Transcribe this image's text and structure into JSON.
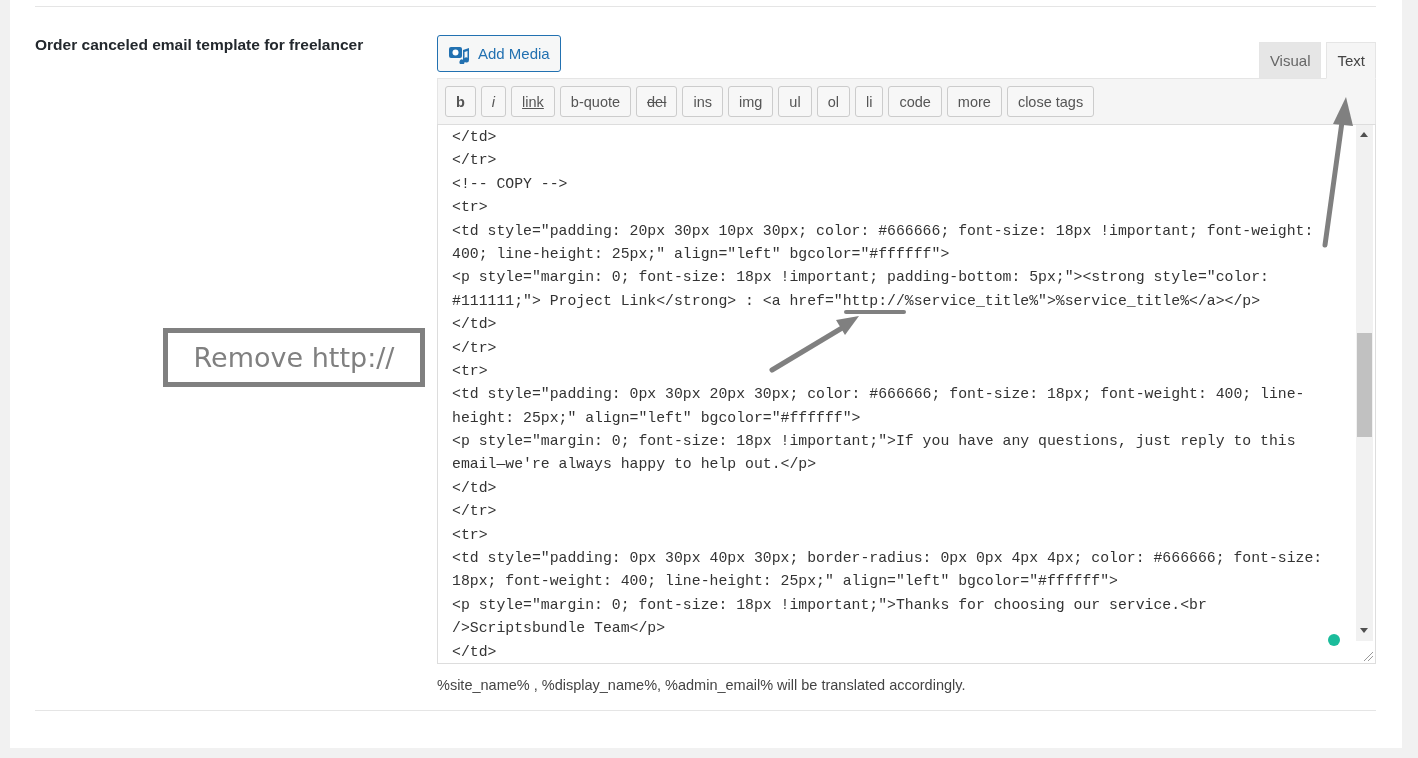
{
  "field_label": "Order canceled email template for freelancer",
  "add_media": {
    "label": "Add Media"
  },
  "tabs": [
    {
      "label": "Visual",
      "selected": false
    },
    {
      "label": "Text",
      "selected": true
    }
  ],
  "toolbar": [
    {
      "label": "b",
      "kind": "bold"
    },
    {
      "label": "i",
      "kind": "italic"
    },
    {
      "label": "link",
      "kind": "underline"
    },
    {
      "label": "b-quote",
      "kind": "plain"
    },
    {
      "label": "del",
      "kind": "strike"
    },
    {
      "label": "ins",
      "kind": "plain"
    },
    {
      "label": "img",
      "kind": "plain"
    },
    {
      "label": "ul",
      "kind": "plain"
    },
    {
      "label": "ol",
      "kind": "plain"
    },
    {
      "label": "li",
      "kind": "plain"
    },
    {
      "label": "code",
      "kind": "plain"
    },
    {
      "label": "more",
      "kind": "plain"
    },
    {
      "label": "close tags",
      "kind": "plain"
    }
  ],
  "code_lines": [
    "</td>",
    "</tr>",
    "<!-- COPY -->",
    "<tr>",
    "<td style=\"padding: 20px 30px 10px 30px; color: #666666; font-size: 18px !important; font-weight:",
    "400; line-height: 25px;\" align=\"left\" bgcolor=\"#ffffff\">",
    "<p style=\"margin: 0; font-size: 18px !important; padding-bottom: 5px;\"><strong style=\"color:",
    "#111111;\"> Project Link</strong> : <a href=\"http://%service_title%\">%service_title%</a></p>",
    "</td>",
    "</tr>",
    "<tr>",
    "<td style=\"padding: 0px 30px 20px 30px; color: #666666; font-size: 18px; font-weight: 400; line-",
    "height: 25px;\" align=\"left\" bgcolor=\"#ffffff\">",
    "<p style=\"margin: 0; font-size: 18px !important;\">If you have any questions, just reply to this",
    "email—we're always happy to help out.</p>",
    "</td>",
    "</tr>",
    "<tr>",
    "<td style=\"padding: 0px 30px 40px 30px; border-radius: 0px 0px 4px 4px; color: #666666; font-size:",
    "18px; font-weight: 400; line-height: 25px;\" align=\"left\" bgcolor=\"#ffffff\">",
    "<p style=\"margin: 0; font-size: 18px !important;\">Thanks for choosing our service.<br",
    "/>Scriptsbundle Team</p>",
    "</td>"
  ],
  "description": "%site_name% , %display_name%, %admin_email% will be translated accordingly.",
  "annotation": {
    "callout": "Remove http://"
  }
}
